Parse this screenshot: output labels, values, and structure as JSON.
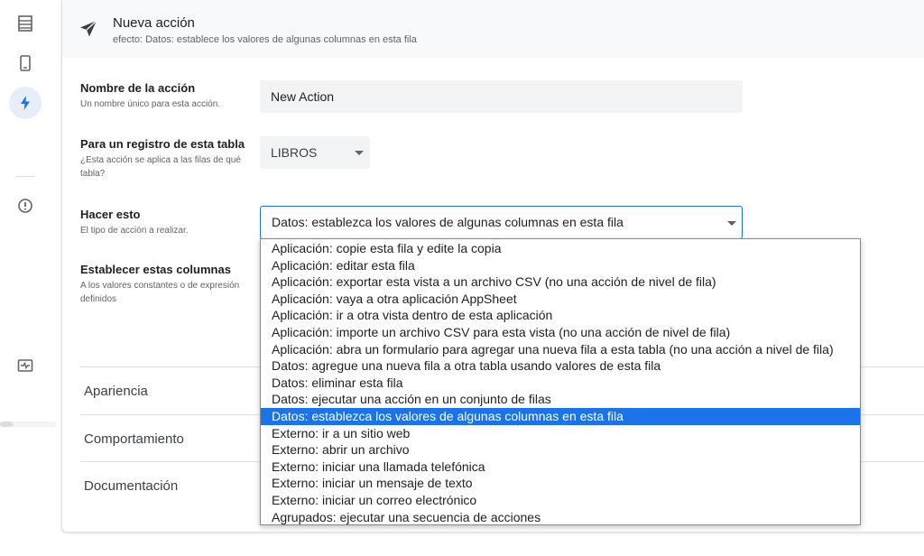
{
  "rail": {
    "icons": [
      "table-icon",
      "phone-icon",
      "lightning-icon",
      "alert-icon",
      "activity-icon"
    ],
    "active": "lightning-icon"
  },
  "header": {
    "title": "Nueva acción",
    "subtitle": "efecto: Datos: establece los valores de algunas columnas en esta fila"
  },
  "fields": {
    "name": {
      "label": "Nombre de la acción",
      "help": "Un nombre único para esta acción.",
      "value": "New Action"
    },
    "table": {
      "label": "Para un registro de esta tabla",
      "help": "¿Esta acción se aplica a las filas de qué tabla?",
      "value": "LIBROS"
    },
    "do_this": {
      "label": "Hacer esto",
      "help": "El tipo de acción a realizar.",
      "value": "Datos: establezca los valores de algunas columnas en esta fila"
    },
    "set_columns": {
      "label": "Establecer estas columnas",
      "help": "A los valores constantes o de expresión definidos"
    }
  },
  "sections": [
    "Apariencia",
    "Comportamiento",
    "Documentación"
  ],
  "dropdown": {
    "selected_index": 10,
    "options": [
      "Aplicación: copie esta fila y edite la copia",
      "Aplicación: editar esta fila",
      "Aplicación: exportar esta vista a un archivo CSV (no una acción de nivel de fila)",
      "Aplicación: vaya a otra aplicación AppSheet",
      "Aplicación: ir a otra vista dentro de esta aplicación",
      "Aplicación: importe un archivo CSV para esta vista (no una acción de nivel de fila)",
      "Aplicación: abra un formulario para agregar una nueva fila a esta tabla (no una acción a nivel de fila)",
      "Datos: agregue una nueva fila a otra tabla usando valores de esta fila",
      "Datos: eliminar esta fila",
      "Datos: ejecutar una acción en un conjunto de filas",
      "Datos: establezca los valores de algunas columnas en esta fila",
      "Externo: ir a un sitio web",
      "Externo: abrir un archivo",
      "Externo: iniciar una llamada telefónica",
      "Externo: iniciar un mensaje de texto",
      "Externo: iniciar un correo electrónico",
      "Agrupados: ejecutar una secuencia de acciones"
    ]
  },
  "colors": {
    "accent": "#1a73e8",
    "rail_active_bg": "#e8eef9",
    "input_bg": "#f1f3f4"
  }
}
